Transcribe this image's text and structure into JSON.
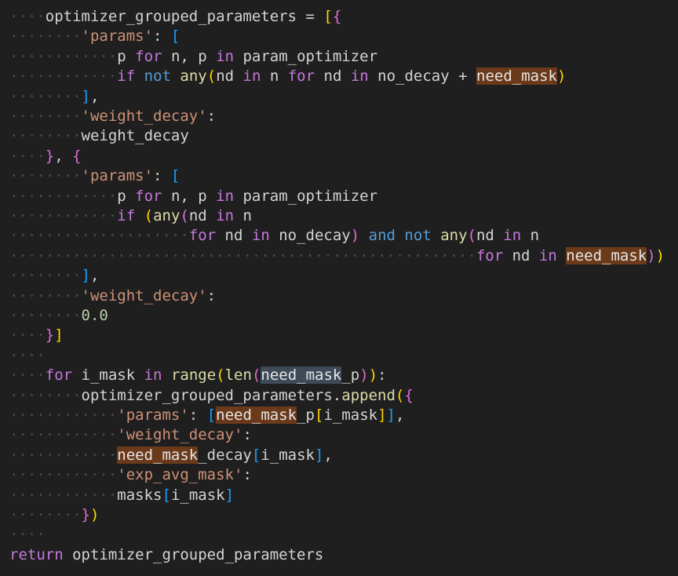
{
  "editor": {
    "language": "python",
    "colors": {
      "background": "#1f1f1f",
      "keyword": "#c678dd",
      "keyword_blue": "#569cd6",
      "function": "#dcdcaa",
      "string": "#ce9178",
      "number": "#b5cea8",
      "highlight": "#6b3a1a",
      "selection": "#3e4a57"
    },
    "lines": [
      {
        "indent": 1,
        "tokens": [
          {
            "t": "optimizer_grouped_parameters",
            "c": "id"
          },
          {
            "t": " = ",
            "c": "op"
          },
          {
            "t": "[",
            "c": "b1"
          },
          {
            "t": "{",
            "c": "b2"
          }
        ]
      },
      {
        "indent": 2,
        "tokens": [
          {
            "t": "'params'",
            "c": "str"
          },
          {
            "t": ": ",
            "c": "op"
          },
          {
            "t": "[",
            "c": "b3"
          }
        ]
      },
      {
        "indent": 3,
        "tokens": [
          {
            "t": "p ",
            "c": "id"
          },
          {
            "t": "for",
            "c": "kw"
          },
          {
            "t": " n, p ",
            "c": "id"
          },
          {
            "t": "in",
            "c": "kw"
          },
          {
            "t": " param_optimizer",
            "c": "id"
          }
        ]
      },
      {
        "indent": 3,
        "tokens": [
          {
            "t": "if",
            "c": "kw"
          },
          {
            "t": " ",
            "c": "op"
          },
          {
            "t": "not",
            "c": "kw2"
          },
          {
            "t": " ",
            "c": "op"
          },
          {
            "t": "any",
            "c": "fn"
          },
          {
            "t": "(",
            "c": "b1"
          },
          {
            "t": "nd ",
            "c": "id"
          },
          {
            "t": "in",
            "c": "kw"
          },
          {
            "t": " n ",
            "c": "id"
          },
          {
            "t": "for",
            "c": "kw"
          },
          {
            "t": " nd ",
            "c": "id"
          },
          {
            "t": "in",
            "c": "kw"
          },
          {
            "t": " no_decay + ",
            "c": "id"
          },
          {
            "t": "need_mask",
            "c": "hl"
          },
          {
            "t": ")",
            "c": "b1"
          }
        ]
      },
      {
        "indent": 2,
        "tokens": [
          {
            "t": "]",
            "c": "b3"
          },
          {
            "t": ",",
            "c": "op"
          }
        ]
      },
      {
        "indent": 2,
        "tokens": [
          {
            "t": "'weight_decay'",
            "c": "str"
          },
          {
            "t": ":",
            "c": "op"
          }
        ]
      },
      {
        "indent": 2,
        "tokens": [
          {
            "t": "weight_decay",
            "c": "id"
          }
        ]
      },
      {
        "indent": 1,
        "tokens": [
          {
            "t": "}",
            "c": "b2"
          },
          {
            "t": ", ",
            "c": "op"
          },
          {
            "t": "{",
            "c": "b2"
          }
        ]
      },
      {
        "indent": 2,
        "tokens": [
          {
            "t": "'params'",
            "c": "str"
          },
          {
            "t": ": ",
            "c": "op"
          },
          {
            "t": "[",
            "c": "b3"
          }
        ]
      },
      {
        "indent": 3,
        "tokens": [
          {
            "t": "p ",
            "c": "id"
          },
          {
            "t": "for",
            "c": "kw"
          },
          {
            "t": " n, p ",
            "c": "id"
          },
          {
            "t": "in",
            "c": "kw"
          },
          {
            "t": " param_optimizer",
            "c": "id"
          }
        ]
      },
      {
        "indent": 3,
        "tokens": [
          {
            "t": "if",
            "c": "kw"
          },
          {
            "t": " ",
            "c": "op"
          },
          {
            "t": "(",
            "c": "b1"
          },
          {
            "t": "any",
            "c": "fn"
          },
          {
            "t": "(",
            "c": "b2"
          },
          {
            "t": "nd ",
            "c": "id"
          },
          {
            "t": "in",
            "c": "kw"
          },
          {
            "t": " n",
            "c": "id"
          }
        ]
      },
      {
        "indent": 5,
        "tokens": [
          {
            "t": "for",
            "c": "kw"
          },
          {
            "t": " nd ",
            "c": "id"
          },
          {
            "t": "in",
            "c": "kw"
          },
          {
            "t": " no_decay",
            "c": "id"
          },
          {
            "t": ")",
            "c": "b2"
          },
          {
            "t": " ",
            "c": "op"
          },
          {
            "t": "and",
            "c": "kw2"
          },
          {
            "t": " ",
            "c": "op"
          },
          {
            "t": "not",
            "c": "kw2"
          },
          {
            "t": " ",
            "c": "op"
          },
          {
            "t": "any",
            "c": "fn"
          },
          {
            "t": "(",
            "c": "b2"
          },
          {
            "t": "nd ",
            "c": "id"
          },
          {
            "t": "in",
            "c": "kw"
          },
          {
            "t": " n",
            "c": "id"
          }
        ]
      },
      {
        "indent": 13,
        "tokens": [
          {
            "t": "for",
            "c": "kw"
          },
          {
            "t": " nd ",
            "c": "id"
          },
          {
            "t": "in",
            "c": "kw"
          },
          {
            "t": " ",
            "c": "op"
          },
          {
            "t": "need_mask",
            "c": "hl"
          },
          {
            "t": ")",
            "c": "b2"
          },
          {
            "t": ")",
            "c": "b1"
          }
        ]
      },
      {
        "indent": 2,
        "tokens": [
          {
            "t": "]",
            "c": "b3"
          },
          {
            "t": ",",
            "c": "op"
          }
        ]
      },
      {
        "indent": 2,
        "tokens": [
          {
            "t": "'weight_decay'",
            "c": "str"
          },
          {
            "t": ":",
            "c": "op"
          }
        ]
      },
      {
        "indent": 2,
        "tokens": [
          {
            "t": "0.0",
            "c": "num"
          }
        ]
      },
      {
        "indent": 1,
        "tokens": [
          {
            "t": "}",
            "c": "b2"
          },
          {
            "t": "]",
            "c": "b1"
          }
        ]
      },
      {
        "indent": 0,
        "tokens": []
      },
      {
        "indent": 1,
        "tokens": [
          {
            "t": "for",
            "c": "kw"
          },
          {
            "t": " i_mask ",
            "c": "id"
          },
          {
            "t": "in",
            "c": "kw"
          },
          {
            "t": " ",
            "c": "op"
          },
          {
            "t": "range",
            "c": "fn"
          },
          {
            "t": "(",
            "c": "b1"
          },
          {
            "t": "len",
            "c": "fn"
          },
          {
            "t": "(",
            "c": "b2"
          },
          {
            "t": "need_mask",
            "c": "hl2"
          },
          {
            "t": "_p",
            "c": "id"
          },
          {
            "t": ")",
            "c": "b2"
          },
          {
            "t": ")",
            "c": "b1"
          },
          {
            "t": ":",
            "c": "op"
          }
        ]
      },
      {
        "indent": 2,
        "tokens": [
          {
            "t": "optimizer_grouped_parameters.",
            "c": "id"
          },
          {
            "t": "append",
            "c": "fn"
          },
          {
            "t": "(",
            "c": "b1"
          },
          {
            "t": "{",
            "c": "b2"
          }
        ]
      },
      {
        "indent": 3,
        "tokens": [
          {
            "t": "'params'",
            "c": "str"
          },
          {
            "t": ": ",
            "c": "op"
          },
          {
            "t": "[",
            "c": "b3"
          },
          {
            "t": "need_mask",
            "c": "hl"
          },
          {
            "t": "_p",
            "c": "id"
          },
          {
            "t": "[",
            "c": "b1"
          },
          {
            "t": "i_mask",
            "c": "id"
          },
          {
            "t": "]",
            "c": "b1"
          },
          {
            "t": "]",
            "c": "b3"
          },
          {
            "t": ",",
            "c": "op"
          }
        ]
      },
      {
        "indent": 3,
        "tokens": [
          {
            "t": "'weight_decay'",
            "c": "str"
          },
          {
            "t": ":",
            "c": "op"
          }
        ]
      },
      {
        "indent": 3,
        "tokens": [
          {
            "t": "need_mask",
            "c": "hl"
          },
          {
            "t": "_decay",
            "c": "id"
          },
          {
            "t": "[",
            "c": "b3"
          },
          {
            "t": "i_mask",
            "c": "id"
          },
          {
            "t": "]",
            "c": "b3"
          },
          {
            "t": ",",
            "c": "op"
          }
        ]
      },
      {
        "indent": 3,
        "tokens": [
          {
            "t": "'exp_avg_mask'",
            "c": "str"
          },
          {
            "t": ":",
            "c": "op"
          }
        ]
      },
      {
        "indent": 3,
        "tokens": [
          {
            "t": "masks",
            "c": "id"
          },
          {
            "t": "[",
            "c": "b3"
          },
          {
            "t": "i_mask",
            "c": "id"
          },
          {
            "t": "]",
            "c": "b3"
          }
        ]
      },
      {
        "indent": 2,
        "tokens": [
          {
            "t": "}",
            "c": "b2"
          },
          {
            "t": ")",
            "c": "b1"
          }
        ]
      },
      {
        "indent": 0,
        "tokens": []
      },
      {
        "indent": 0,
        "tokens": [
          {
            "t": "return",
            "c": "kw"
          },
          {
            "t": " optimizer_grouped_parameters",
            "c": "id"
          }
        ]
      }
    ]
  }
}
